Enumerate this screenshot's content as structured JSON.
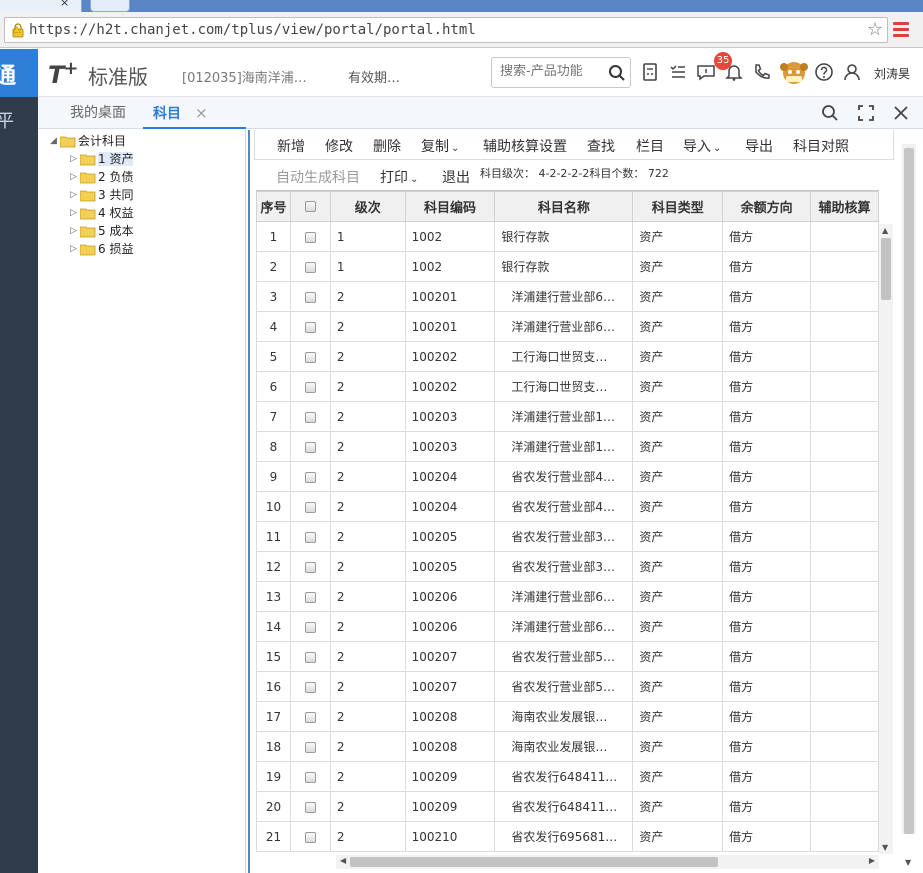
{
  "browser": {
    "url": "https://h2t.chanjet.com/tplus/view/portal/portal.html"
  },
  "header": {
    "brand_glyph": "通",
    "logo_text": "T",
    "logo_plus": "+",
    "edition": "标准版",
    "account": "[012035]海南洋浦…",
    "validity": "有效期…",
    "search_placeholder": "搜索-产品功能",
    "notification_count": "35",
    "user_name": "刘涛昊"
  },
  "leftrail": {
    "glyph": "平"
  },
  "tabs": {
    "home": "我的桌面",
    "active": "科目",
    "close": "×"
  },
  "tree": {
    "root": "会计科目",
    "children": [
      "1 资产",
      "2 负债",
      "3 共同",
      "4 权益",
      "5 成本",
      "6 损益"
    ]
  },
  "toolbar": {
    "add": "新增",
    "edit": "修改",
    "delete": "删除",
    "copy": "复制",
    "aux_setup": "辅助核算设置",
    "find": "查找",
    "columns": "栏目",
    "import": "导入",
    "export": "导出",
    "compare": "科目对照",
    "auto_generate": "自动生成科目",
    "print": "打印",
    "exit": "退出",
    "level_info": "科目级次： 4-2-2-2-2科目个数： 722"
  },
  "grid": {
    "columns": [
      "序号",
      "级次",
      "科目编码",
      "科目名称",
      "科目类型",
      "余额方向",
      "辅助核算"
    ],
    "rows": [
      {
        "seq": "1",
        "level": "1",
        "code": "1002",
        "name": "银行存款",
        "type": "资产",
        "dir": "借方"
      },
      {
        "seq": "2",
        "level": "1",
        "code": "1002",
        "name": "银行存款",
        "type": "资产",
        "dir": "借方"
      },
      {
        "seq": "3",
        "level": "2",
        "code": "100201",
        "name": "洋浦建行营业部6…",
        "type": "资产",
        "dir": "借方"
      },
      {
        "seq": "4",
        "level": "2",
        "code": "100201",
        "name": "洋浦建行营业部6…",
        "type": "资产",
        "dir": "借方"
      },
      {
        "seq": "5",
        "level": "2",
        "code": "100202",
        "name": "工行海口世贸支…",
        "type": "资产",
        "dir": "借方"
      },
      {
        "seq": "6",
        "level": "2",
        "code": "100202",
        "name": "工行海口世贸支…",
        "type": "资产",
        "dir": "借方"
      },
      {
        "seq": "7",
        "level": "2",
        "code": "100203",
        "name": "洋浦建行营业部1…",
        "type": "资产",
        "dir": "借方"
      },
      {
        "seq": "8",
        "level": "2",
        "code": "100203",
        "name": "洋浦建行营业部1…",
        "type": "资产",
        "dir": "借方"
      },
      {
        "seq": "9",
        "level": "2",
        "code": "100204",
        "name": "省农发行营业部4…",
        "type": "资产",
        "dir": "借方"
      },
      {
        "seq": "10",
        "level": "2",
        "code": "100204",
        "name": "省农发行营业部4…",
        "type": "资产",
        "dir": "借方"
      },
      {
        "seq": "11",
        "level": "2",
        "code": "100205",
        "name": "省农发行营业部3…",
        "type": "资产",
        "dir": "借方"
      },
      {
        "seq": "12",
        "level": "2",
        "code": "100205",
        "name": "省农发行营业部3…",
        "type": "资产",
        "dir": "借方"
      },
      {
        "seq": "13",
        "level": "2",
        "code": "100206",
        "name": "洋浦建行营业部6…",
        "type": "资产",
        "dir": "借方"
      },
      {
        "seq": "14",
        "level": "2",
        "code": "100206",
        "name": "洋浦建行营业部6…",
        "type": "资产",
        "dir": "借方"
      },
      {
        "seq": "15",
        "level": "2",
        "code": "100207",
        "name": "省农发行营业部5…",
        "type": "资产",
        "dir": "借方"
      },
      {
        "seq": "16",
        "level": "2",
        "code": "100207",
        "name": "省农发行营业部5…",
        "type": "资产",
        "dir": "借方"
      },
      {
        "seq": "17",
        "level": "2",
        "code": "100208",
        "name": "海南农业发展银…",
        "type": "资产",
        "dir": "借方"
      },
      {
        "seq": "18",
        "level": "2",
        "code": "100208",
        "name": "海南农业发展银…",
        "type": "资产",
        "dir": "借方"
      },
      {
        "seq": "19",
        "level": "2",
        "code": "100209",
        "name": "省农发行648411…",
        "type": "资产",
        "dir": "借方"
      },
      {
        "seq": "20",
        "level": "2",
        "code": "100209",
        "name": "省农发行648411…",
        "type": "资产",
        "dir": "借方"
      },
      {
        "seq": "21",
        "level": "2",
        "code": "100210",
        "name": "省农发行695681…",
        "type": "资产",
        "dir": "借方"
      }
    ]
  }
}
